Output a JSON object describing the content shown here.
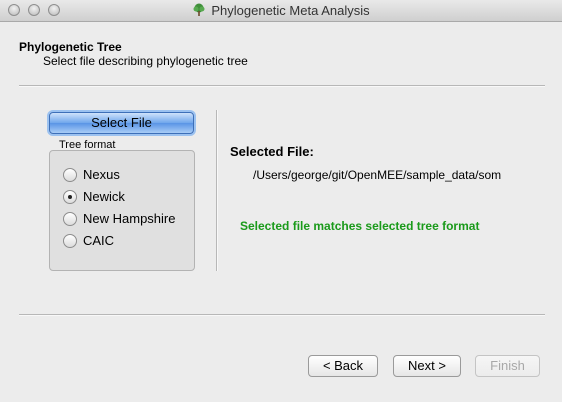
{
  "window": {
    "title": "Phylogenetic Meta Analysis",
    "icon": "tree-icon"
  },
  "header": {
    "title": "Phylogenetic Tree",
    "subtitle": "Select file describing phylogenetic tree"
  },
  "select_file_button": "Select File",
  "tree_format": {
    "label": "Tree format",
    "options": [
      "Nexus",
      "Newick",
      "New Hampshire",
      "CAIC"
    ],
    "selected": "Newick"
  },
  "selected_file": {
    "label": "Selected File:",
    "path": "/Users/george/git/OpenMEE/sample_data/som"
  },
  "status_message": "Selected file matches selected tree format",
  "buttons": {
    "back": "< Back",
    "next": "Next >",
    "finish": "Finish"
  },
  "colors": {
    "status_green": "#1a9a1a",
    "default_button_blue": "#6fa6ec"
  }
}
